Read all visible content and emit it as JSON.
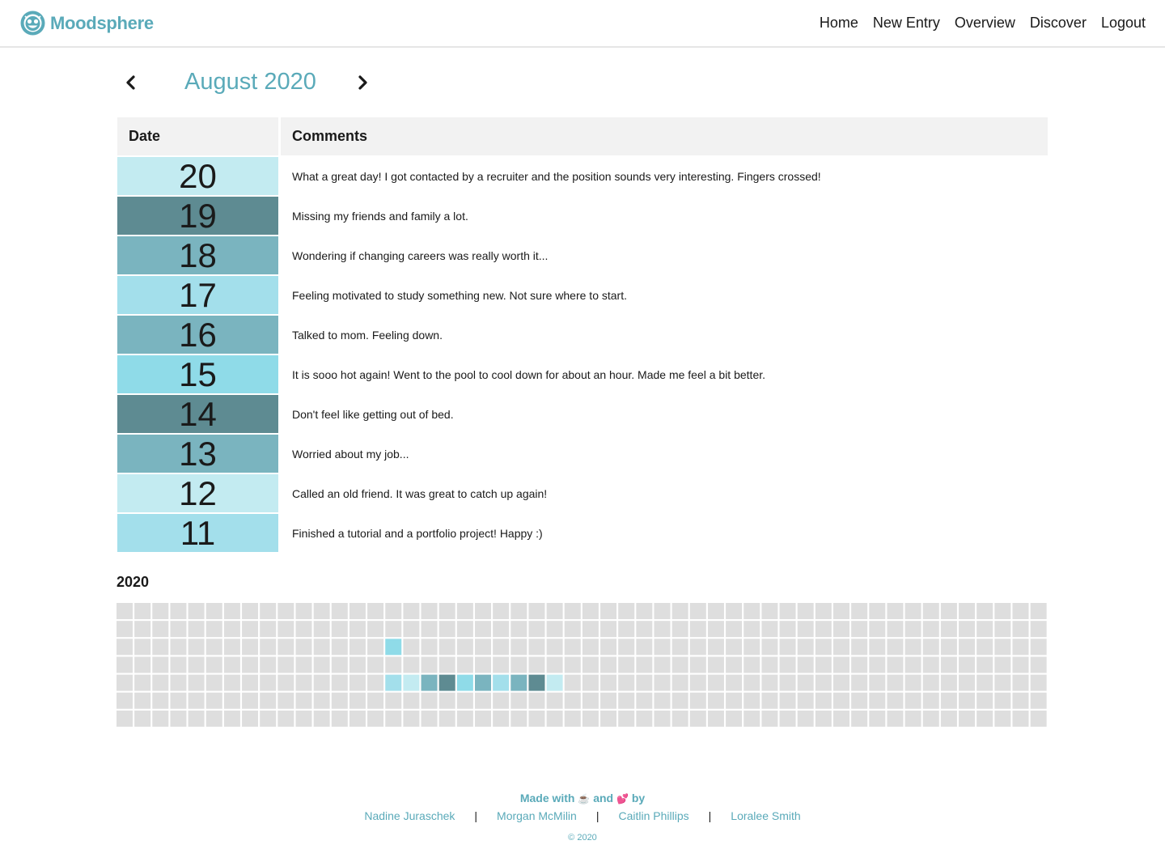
{
  "brand": {
    "name": "Moodsphere"
  },
  "nav": [
    "Home",
    "New Entry",
    "Overview",
    "Discover",
    "Logout"
  ],
  "month": {
    "title": "August 2020"
  },
  "table": {
    "headers": {
      "date": "Date",
      "comments": "Comments"
    },
    "rows": [
      {
        "day": "20",
        "color": "#c3ebf1",
        "comment": "What a great day! I got contacted by a recruiter and the position sounds very interesting. Fingers crossed!"
      },
      {
        "day": "19",
        "color": "#5e8b92",
        "comment": "Missing my friends and family a lot."
      },
      {
        "day": "18",
        "color": "#7ab4bf",
        "comment": "Wondering if changing careers was really worth it..."
      },
      {
        "day": "17",
        "color": "#a3dfeb",
        "comment": "Feeling motivated to study something new. Not sure where to start."
      },
      {
        "day": "16",
        "color": "#7ab4bf",
        "comment": "Talked to mom. Feeling down."
      },
      {
        "day": "15",
        "color": "#8fdbe8",
        "comment": "It is sooo hot again! Went to the pool to cool down for about an hour. Made me feel a bit better."
      },
      {
        "day": "14",
        "color": "#5e8b92",
        "comment": "Don't feel like getting out of bed."
      },
      {
        "day": "13",
        "color": "#7ab4bf",
        "comment": "Worried about my job..."
      },
      {
        "day": "12",
        "color": "#c3ebf1",
        "comment": "Called an old friend. It was great to catch up again!"
      },
      {
        "day": "11",
        "color": "#a3dfeb",
        "comment": "Finished a tutorial and a portfolio project! Happy :)"
      }
    ]
  },
  "year": {
    "label": "2020",
    "weeks": 52,
    "days": 7,
    "empty_color": "#dedede",
    "filled": [
      {
        "week": 15,
        "day": 2,
        "color": "#8fdbe8"
      },
      {
        "week": 15,
        "day": 4,
        "color": "#a3dfeb"
      },
      {
        "week": 16,
        "day": 4,
        "color": "#c3ebf1"
      },
      {
        "week": 17,
        "day": 4,
        "color": "#7ab4bf"
      },
      {
        "week": 18,
        "day": 4,
        "color": "#5e8b92"
      },
      {
        "week": 19,
        "day": 4,
        "color": "#8fdbe8"
      },
      {
        "week": 20,
        "day": 4,
        "color": "#7ab4bf"
      },
      {
        "week": 21,
        "day": 4,
        "color": "#a3dfeb"
      },
      {
        "week": 22,
        "day": 4,
        "color": "#7ab4bf"
      },
      {
        "week": 23,
        "day": 4,
        "color": "#5e8b92"
      },
      {
        "week": 24,
        "day": 4,
        "color": "#c3ebf1"
      }
    ]
  },
  "footer": {
    "made_with": "Made with",
    "coffee": "☕",
    "and": "and",
    "hearts": "💕",
    "by": "by",
    "authors": [
      "Nadine Juraschek",
      "Morgan McMilin",
      "Caitlin Phillips",
      "Loralee Smith"
    ],
    "separator": "|",
    "copyright": "© 2020"
  },
  "colors": {
    "accent": "#5aaab9"
  }
}
